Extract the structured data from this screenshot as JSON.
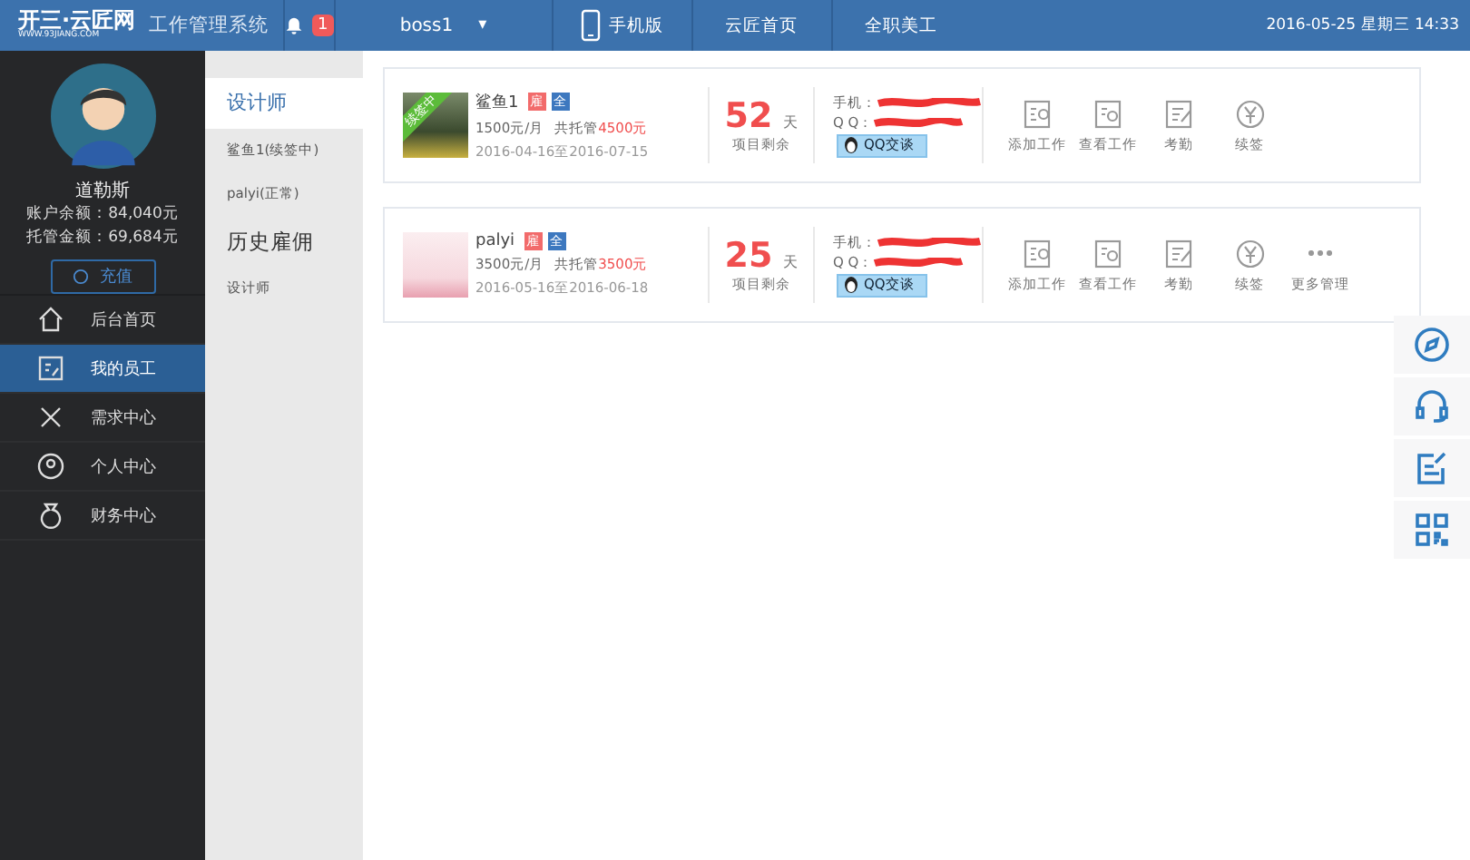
{
  "header": {
    "logo": "开三·云匠网",
    "logo_sub": "WWW.93JIANG.COM",
    "system_title": "工作管理系统",
    "notification_count": "1",
    "user": "boss1",
    "user_caret": "▾",
    "nav": [
      {
        "label": "手机版",
        "kind": "phone"
      },
      {
        "label": "云匠首页",
        "kind": "plain"
      },
      {
        "label": "全职美工",
        "kind": "plain"
      }
    ],
    "datetime": "2016-05-25 星期三 14:33"
  },
  "profile": {
    "name": "道勒斯",
    "balance": "账户余额：84,040元",
    "escrow": "托管金额：69,684元",
    "recharge": "充值"
  },
  "menu": [
    {
      "label": "后台首页",
      "selected": false
    },
    {
      "label": "我的员工",
      "selected": true
    },
    {
      "label": "需求中心",
      "selected": false
    },
    {
      "label": "个人中心",
      "selected": false
    },
    {
      "label": "财务中心",
      "selected": false
    }
  ],
  "subnav": [
    {
      "label": "设计师",
      "kind": "header",
      "selected": true
    },
    {
      "label": "鲨鱼1(续签中)",
      "kind": "item",
      "selected": false
    },
    {
      "label": "palyi(正常)",
      "kind": "item",
      "selected": false
    },
    {
      "label": "历史雇佣",
      "kind": "section",
      "selected": false
    },
    {
      "label": "设计师",
      "kind": "item",
      "selected": false
    }
  ],
  "employees": [
    {
      "ribbon": "续签中",
      "name": "鲨鱼1",
      "badges": [
        "雇",
        "全"
      ],
      "rate": "1500元/月",
      "escrow_label": "共托管",
      "escrow_amount": "4500元",
      "period": "2016-04-16至2016-07-15",
      "days": "52",
      "days_unit": "天",
      "days_label": "项目剩余",
      "phone_label": "手机：",
      "qq_label": "Q Q：",
      "qq_button": "QQ交谈",
      "actions": [
        {
          "label": "添加工作"
        },
        {
          "label": "查看工作"
        },
        {
          "label": "考勤"
        },
        {
          "label": "续签"
        }
      ]
    },
    {
      "name": "palyi",
      "badges": [
        "雇",
        "全"
      ],
      "rate": "3500元/月",
      "escrow_label": "共托管",
      "escrow_amount": "3500元",
      "period": "2016-05-16至2016-06-18",
      "days": "25",
      "days_unit": "天",
      "days_label": "项目剩余",
      "phone_label": "手机：",
      "qq_label": "Q Q：",
      "qq_button": "QQ交谈",
      "actions": [
        {
          "label": "添加工作"
        },
        {
          "label": "查看工作"
        },
        {
          "label": "考勤"
        },
        {
          "label": "续签"
        },
        {
          "label": "更多管理"
        }
      ]
    }
  ]
}
